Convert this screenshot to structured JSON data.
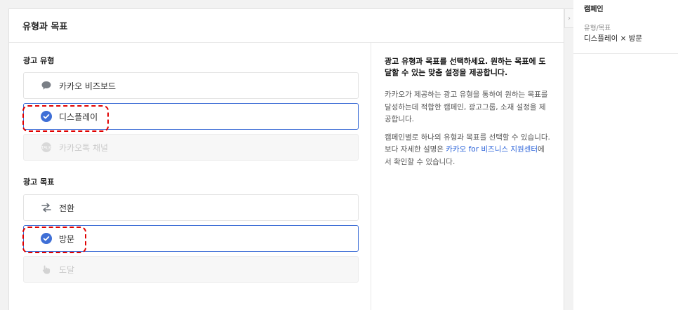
{
  "panel": {
    "title": "유형과 목표"
  },
  "ad_type": {
    "title": "광고 유형",
    "options": [
      {
        "label": "카카오 비즈보드"
      },
      {
        "label": "디스플레이"
      },
      {
        "label": "카카오톡 채널"
      }
    ]
  },
  "ad_goal": {
    "title": "광고 목표",
    "options": [
      {
        "label": "전환"
      },
      {
        "label": "방문"
      },
      {
        "label": "도달"
      }
    ]
  },
  "description": {
    "heading": "광고 유형과 목표를 선택하세요. 원하는 목표에 도달할 수 있는 맞춤 설정을 제공합니다.",
    "para1": "카카오가 제공하는 광고 유형을 통하여 원하는 목표를 달성하는데 적합한 캠페인, 광고그룹, 소재 설정을 제공합니다.",
    "para2_a": "캠페인별로 하나의 유형과 목표를 선택할 수 있습니다.",
    "para2_b": "보다 자세한 설명은 ",
    "link": "카카오 for 비즈니스 지원센터",
    "para2_c": "에서 확인할 수 있습니다."
  },
  "sidebar": {
    "title": "캠페인",
    "label": "유형/목표",
    "value": "디스플레이 × 방문"
  },
  "colors": {
    "accent": "#3f6fd6",
    "highlight": "#e00000",
    "link": "#2b63d9"
  }
}
